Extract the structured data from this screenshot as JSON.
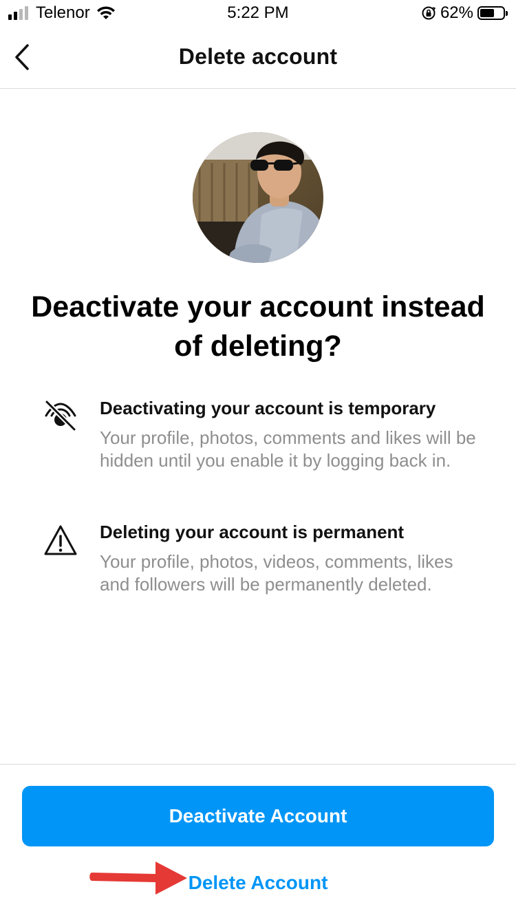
{
  "status_bar": {
    "carrier": "Telenor",
    "time": "5:22 PM",
    "battery_percent": "62%",
    "battery_level": 0.62,
    "signal_bars_filled": 2,
    "signal_bars_total": 4
  },
  "nav": {
    "title": "Delete account",
    "back_icon": "chevron-left-icon"
  },
  "heading": "Deactivate your account instead of deleting?",
  "info_items": [
    {
      "icon": "eye-off-icon",
      "title": "Deactivating your account is temporary",
      "description": "Your profile, photos, comments and likes will be hidden until you enable it by logging back in."
    },
    {
      "icon": "warning-triangle-icon",
      "title": "Deleting your account is permanent",
      "description": "Your profile, photos, videos, comments, likes and followers will be permanently deleted."
    }
  ],
  "actions": {
    "deactivate_label": "Deactivate Account",
    "delete_label": "Delete Account"
  },
  "colors": {
    "accent": "#0095f6",
    "secondary_text": "#8e8e8e",
    "divider": "#dbdbdb",
    "annotation_arrow": "#e53935"
  }
}
